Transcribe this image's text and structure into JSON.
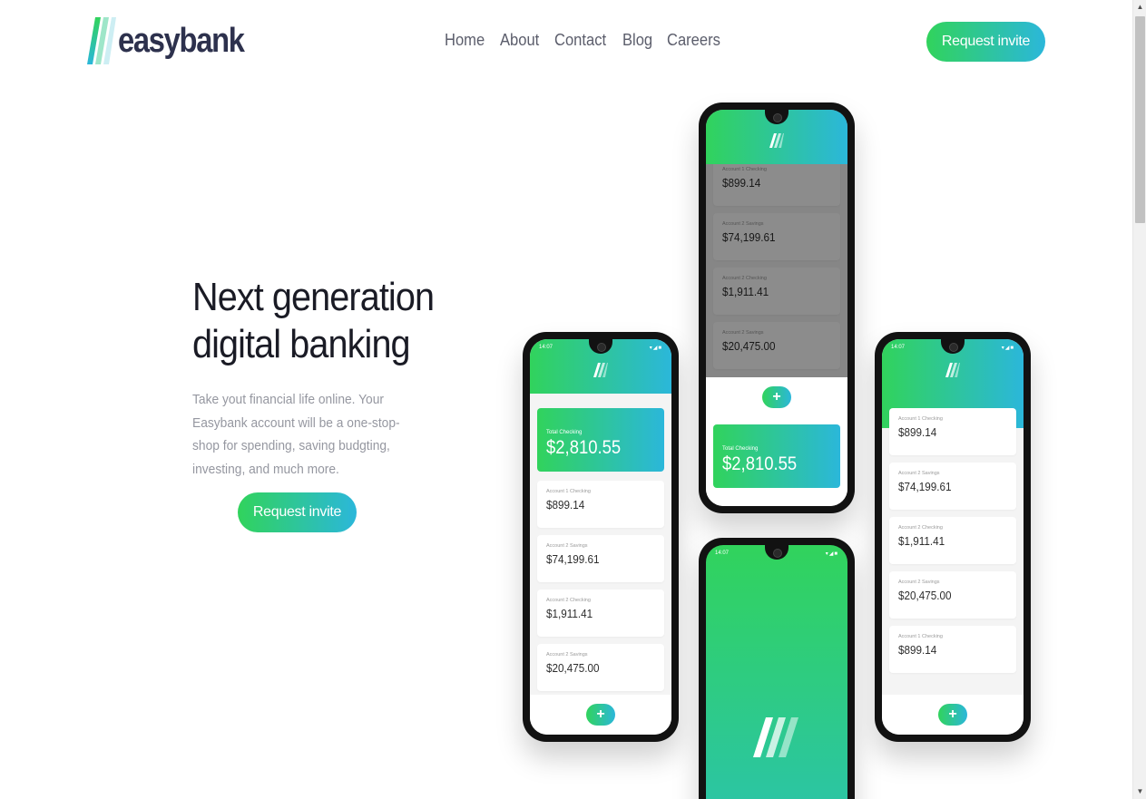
{
  "brand": {
    "name": "easybank"
  },
  "nav": {
    "items": [
      {
        "label": "Home"
      },
      {
        "label": "About"
      },
      {
        "label": "Contact"
      },
      {
        "label": "Blog"
      },
      {
        "label": "Careers"
      }
    ]
  },
  "header": {
    "cta_label": "Request invite"
  },
  "hero": {
    "title_line1": "Next generation",
    "title_line2": "digital banking",
    "text": "Take yout financial life online. Your Easybank account will be a one-stop-shop for spending, saving budgting, investing, and much more.",
    "cta_label": "Request invite"
  },
  "colors": {
    "brand_green": "#31d35c",
    "brand_cyan": "#2bb7da",
    "dark_blue": "#2d314d"
  },
  "phones": {
    "status_time": "14:07",
    "total": {
      "label": "Total Checking",
      "amount": "$2,810.55"
    },
    "accounts": [
      {
        "label": "Account 1 Checking",
        "amount": "$899.14"
      },
      {
        "label": "Account 2 Savings",
        "amount": "$74,199.61"
      },
      {
        "label": "Account 2 Checking",
        "amount": "$1,911.41"
      },
      {
        "label": "Account 2 Savings",
        "amount": "$20,475.00"
      },
      {
        "label": "Account 1 Checking",
        "amount": "$899.14"
      }
    ],
    "fab_icon": "plus-icon"
  }
}
